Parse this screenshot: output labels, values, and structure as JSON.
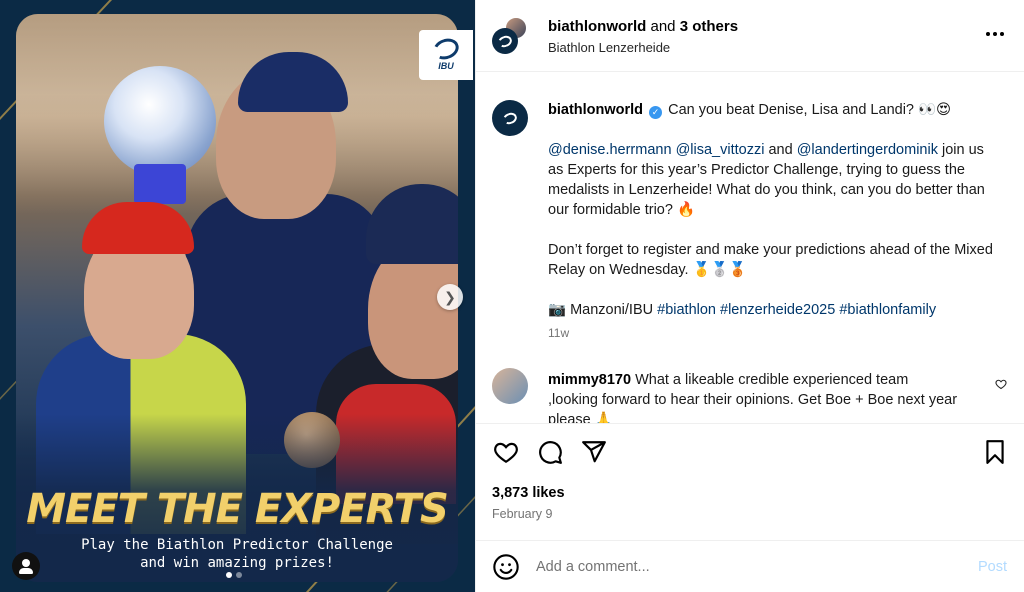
{
  "media": {
    "headline": "MEET THE EXPERTS",
    "subline_1": "Play the Biathlon Predictor Challenge",
    "subline_2": "and win amazing prizes!",
    "logo_text": "IBU",
    "colors": {
      "background": "#0b2a45",
      "headline": "#f2d06b"
    },
    "carousel": {
      "total": 2,
      "active": 1
    }
  },
  "header": {
    "account": "biathlonworld",
    "and_text": " and ",
    "others": "3 others",
    "location": "Biathlon Lenzerheide"
  },
  "caption": {
    "username": "biathlonworld",
    "text_1": "Can you beat Denise, Lisa and Landi? 👀😍",
    "mention_1": "@denise.herrmann",
    "mention_2": "@lisa_vittozzi",
    "and_word": " and ",
    "mention_3": "@landertingerdominik",
    "text_2": " join us as Experts for this year’s Predictor Challenge, trying to guess the medalists in Lenzerheide! What do you think, can you do better than our formidable trio? 🔥",
    "text_3": "Don’t forget to register and make your predictions ahead of the Mixed Relay on Wednesday. 🥇🥈🥉",
    "credit": "📷 Manzoni/IBU ",
    "tag_1": "#biathlon",
    "tag_2": "#lenzerheide2025",
    "tag_3": "#biathlonfamily",
    "time": "11w"
  },
  "comment": {
    "username": "mimmy8170",
    "text": "What a likeable credible experienced team ,looking forward to hear their opinions. Get Boe + Boe next year please 🙏"
  },
  "stats": {
    "likes": "3,873 likes",
    "date": "February 9"
  },
  "add_comment": {
    "placeholder": "Add a comment...",
    "post_label": "Post"
  },
  "icons": [
    "more-icon",
    "verified-icon",
    "heart-icon",
    "comment-icon",
    "share-icon",
    "bookmark-icon",
    "emoji-icon",
    "next-arrow-icon",
    "user-tag-icon"
  ]
}
